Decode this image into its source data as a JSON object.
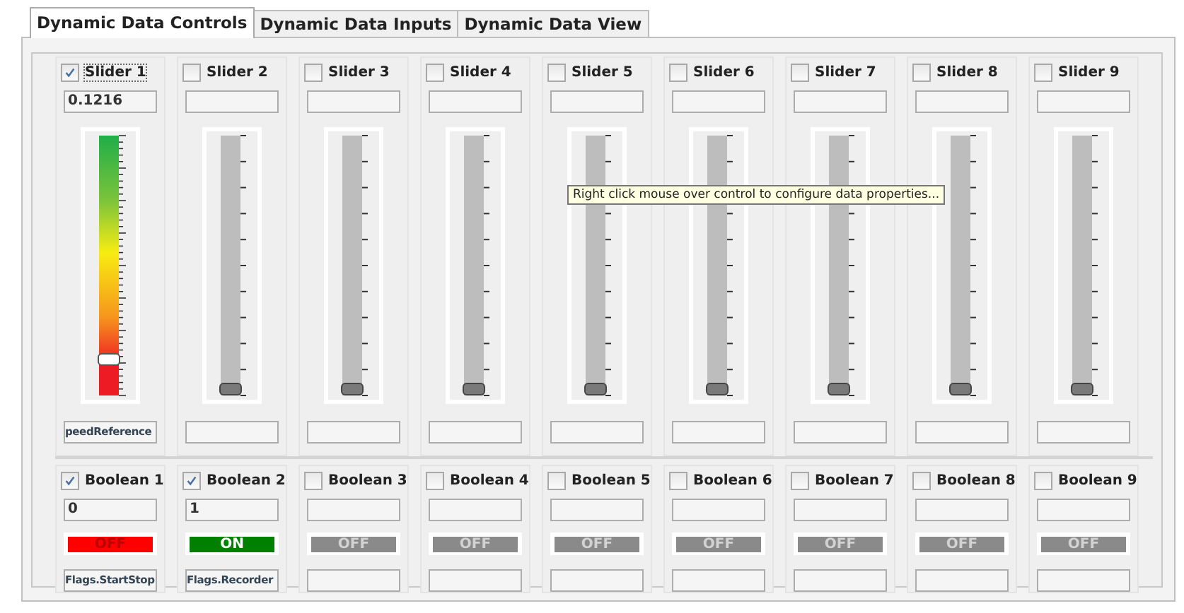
{
  "tabs": [
    {
      "label": "Dynamic Data Controls",
      "selected": true
    },
    {
      "label": "Dynamic Data Inputs",
      "selected": false
    },
    {
      "label": "Dynamic Data View",
      "selected": false
    }
  ],
  "sliders": [
    {
      "label": "Slider 1",
      "checked": true,
      "value": "0.1216",
      "level": 0.12,
      "tag": "peedReference"
    },
    {
      "label": "Slider 2",
      "checked": false,
      "level": 0
    },
    {
      "label": "Slider 3",
      "checked": false,
      "level": 0
    },
    {
      "label": "Slider 4",
      "checked": false,
      "level": 0
    },
    {
      "label": "Slider 5",
      "checked": false,
      "level": 0
    },
    {
      "label": "Slider 6",
      "checked": false,
      "level": 0
    },
    {
      "label": "Slider 7",
      "checked": false,
      "level": 0
    },
    {
      "label": "Slider 8",
      "checked": false,
      "level": 0
    },
    {
      "label": "Slider 9",
      "checked": false,
      "level": 0
    }
  ],
  "booleans": [
    {
      "label": "Boolean 1",
      "checked": true,
      "value": "0",
      "lamp": {
        "label": "OFF",
        "on": false,
        "disabled": false
      },
      "tag": "Flags.StartStop"
    },
    {
      "label": "Boolean 2",
      "checked": true,
      "value": "1",
      "lamp": {
        "label": "ON",
        "on": true,
        "disabled": false
      },
      "tag": "Flags.Recorder"
    },
    {
      "label": "Boolean 3",
      "checked": false,
      "lamp": {
        "label": "OFF",
        "on": false,
        "disabled": true
      }
    },
    {
      "label": "Boolean 4",
      "checked": false,
      "lamp": {
        "label": "OFF",
        "on": false,
        "disabled": true
      }
    },
    {
      "label": "Boolean 5",
      "checked": false,
      "lamp": {
        "label": "OFF",
        "on": false,
        "disabled": true
      }
    },
    {
      "label": "Boolean 6",
      "checked": false,
      "lamp": {
        "label": "OFF",
        "on": false,
        "disabled": true
      }
    },
    {
      "label": "Boolean 7",
      "checked": false,
      "lamp": {
        "label": "OFF",
        "on": false,
        "disabled": true
      }
    },
    {
      "label": "Boolean 8",
      "checked": false,
      "lamp": {
        "label": "OFF",
        "on": false,
        "disabled": true
      }
    },
    {
      "label": "Boolean 9",
      "checked": false,
      "lamp": {
        "label": "OFF",
        "on": false,
        "disabled": true
      }
    }
  ],
  "tooltip": "Right click mouse over control to configure data properties..."
}
